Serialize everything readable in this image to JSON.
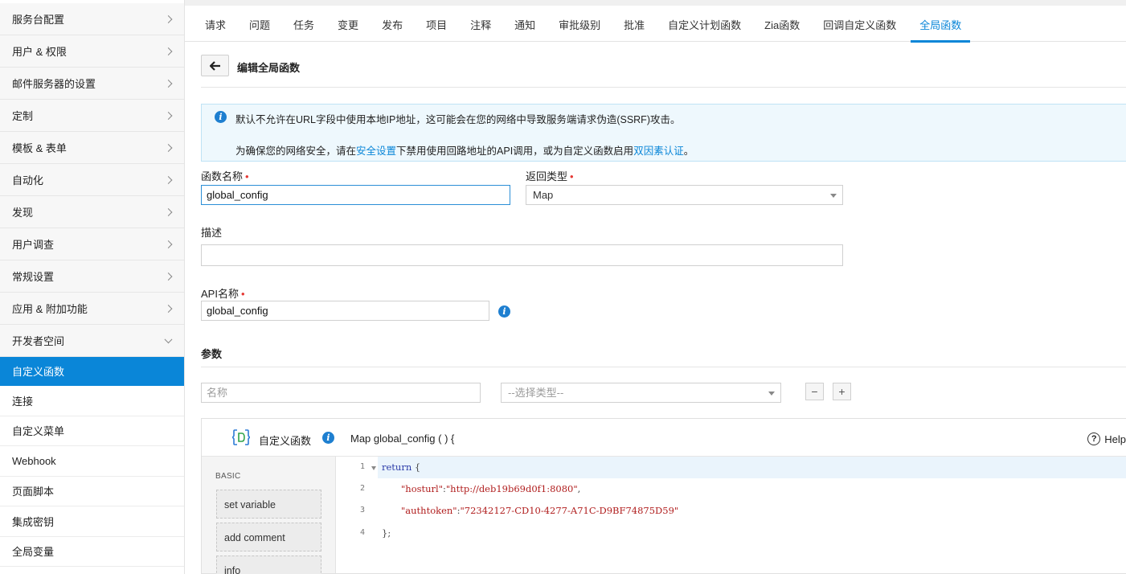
{
  "sidebar": {
    "groups": [
      {
        "label": "服务台配置"
      },
      {
        "label": "用户 & 权限"
      },
      {
        "label": "邮件服务器的设置"
      },
      {
        "label": "定制"
      },
      {
        "label": "模板 & 表单"
      },
      {
        "label": "自动化"
      },
      {
        "label": "发现"
      },
      {
        "label": "用户调查"
      },
      {
        "label": "常规设置"
      },
      {
        "label": "应用 & 附加功能"
      },
      {
        "label": "开发者空间"
      }
    ],
    "sub_items": [
      {
        "label": "自定义函数",
        "active": true
      },
      {
        "label": "连接"
      },
      {
        "label": "自定义菜单"
      },
      {
        "label": "Webhook"
      },
      {
        "label": "页面脚本"
      },
      {
        "label": "集成密钥"
      },
      {
        "label": "全局变量"
      }
    ]
  },
  "tabs": [
    {
      "label": "请求"
    },
    {
      "label": "问题"
    },
    {
      "label": "任务"
    },
    {
      "label": "变更"
    },
    {
      "label": "发布"
    },
    {
      "label": "项目"
    },
    {
      "label": "注释"
    },
    {
      "label": "通知"
    },
    {
      "label": "审批级别"
    },
    {
      "label": "批准"
    },
    {
      "label": "自定义计划函数"
    },
    {
      "label": "Zia函数"
    },
    {
      "label": "回调自定义函数"
    },
    {
      "label": "全局函数",
      "active": true
    }
  ],
  "header": {
    "title": "编辑全局函数"
  },
  "banner": {
    "line1": "默认不允许在URL字段中使用本地IP地址，这可能会在您的网络中导致服务端请求伪造(SSRF)攻击。",
    "line2_pre": "为确保您的网络安全，请在",
    "line2_link1": "安全设置",
    "line2_mid": "下禁用使用回路地址的API调用，或为自定义函数启用",
    "line2_link2": "双因素认证",
    "line2_post": "。"
  },
  "form": {
    "function_name_label": "函数名称",
    "function_name_value": "global_config",
    "return_type_label": "返回类型",
    "return_type_value": "Map",
    "description_label": "描述",
    "description_value": "",
    "api_name_label": "API名称",
    "api_name_value": "global_config",
    "required_mark": "•"
  },
  "params": {
    "section_title": "参数",
    "name_placeholder": "名称",
    "type_placeholder": "--选择类型--",
    "minus": "−",
    "plus": "+"
  },
  "editor": {
    "name": "自定义函数",
    "signature": "Map global_config ( ) {",
    "help": "Help",
    "palette_title": "BASIC",
    "palette_items": [
      "set variable",
      "add comment",
      "info"
    ],
    "line_numbers": [
      "1",
      "2",
      "3",
      "4"
    ],
    "code": {
      "l1_kw": "return",
      "l1_punct": " {",
      "l2_key": "\"hosturl\"",
      "l2_val": "\"http://deb19b69d0f1:8080\"",
      "l3_key": "\"authtoken\"",
      "l3_val": "\"72342127-CD10-4277-A71C-D9BF74875D59\"",
      "l4": "};"
    }
  },
  "colors": {
    "accent": "#0a86d8",
    "banner_bg": "#eef8fd",
    "required": "#e53935"
  }
}
